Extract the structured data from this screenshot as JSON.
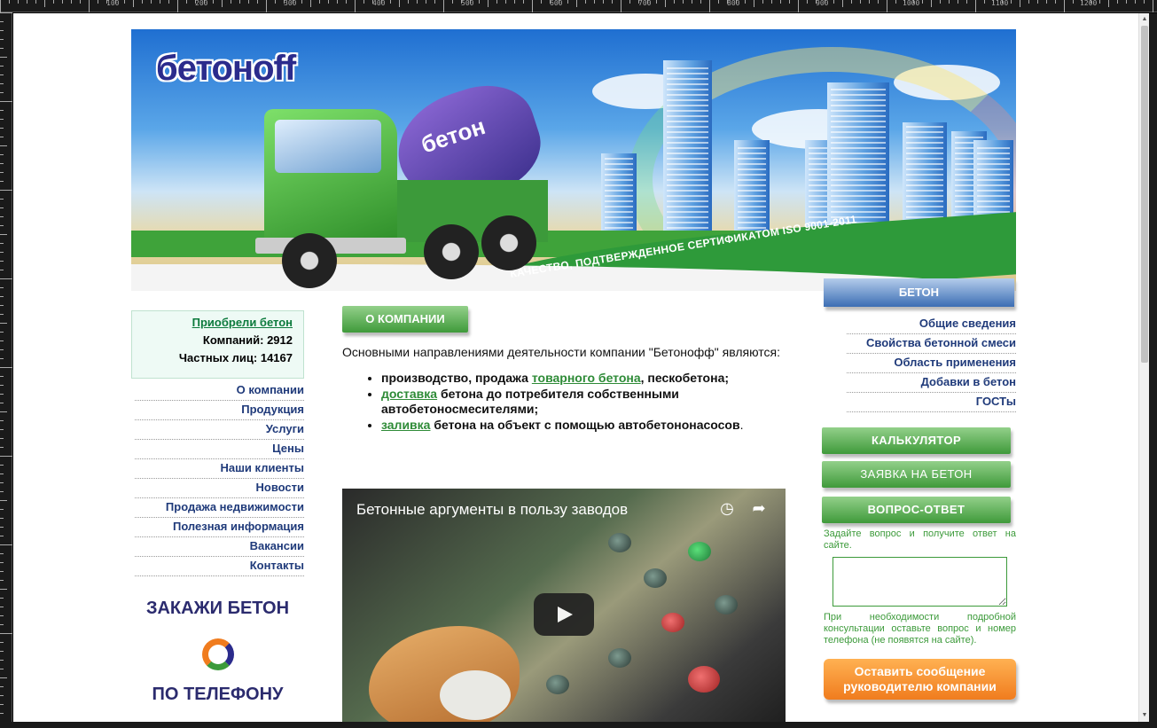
{
  "ruler": {
    "labels": [
      "100",
      "200",
      "300",
      "400",
      "500",
      "600",
      "700",
      "800",
      "900",
      "1000",
      "1100",
      "1200"
    ]
  },
  "banner": {
    "logo_text": "бетонoff",
    "truck_text": "бетон",
    "iso_caption": "КАЧЕСТВО, ПОДТВЕРЖДЕННОЕ СЕРТИФИКАТОМ ISO 9001-2011"
  },
  "buyers": {
    "title": "Приобрели бетон",
    "companies": "Компаний: 2912",
    "persons": "Частных лиц: 14167"
  },
  "left_nav": {
    "items": [
      {
        "label": "О компании"
      },
      {
        "label": "Продукция"
      },
      {
        "label": "Услуги"
      },
      {
        "label": "Цены"
      },
      {
        "label": "Наши клиенты"
      },
      {
        "label": "Новости"
      },
      {
        "label": "Продажа недвижимости"
      },
      {
        "label": "Полезная информация"
      },
      {
        "label": "Вакансии"
      },
      {
        "label": "Контакты"
      }
    ]
  },
  "order": {
    "title": "ЗАКАЖИ БЕТОН",
    "phone": "ПО ТЕЛЕФОНУ"
  },
  "main": {
    "section_button": "О КОМПАНИИ",
    "intro": "Основными направлениями деятельности компании \"Бетонофф\" являются:",
    "dir1_pre": "производство, продажа ",
    "dir1_link": "товарного бетона",
    "dir1_post": ", пескобетона;",
    "dir2_link": "доставка",
    "dir2_post": " бетона до потребителя собственными автобетоносмесителями;",
    "dir3_link": "заливка",
    "dir3_post": " бетона на объект с помощью автобетононасосов",
    "dir3_end": "."
  },
  "video": {
    "title": "Бетонные аргументы в пользу заводов"
  },
  "right": {
    "header": "БЕТОН",
    "items": [
      {
        "label": "Общие сведения"
      },
      {
        "label": "Свойства бетонной смеси"
      },
      {
        "label": "Область применения"
      },
      {
        "label": "Добавки в бетон"
      },
      {
        "label": "ГОСТы"
      }
    ],
    "calc_button": "КАЛЬКУЛЯТОР",
    "request_button": "ЗАЯВКА НА БЕТОН",
    "qa_button": "ВОПРОС-ОТВЕТ",
    "qa_text": "Задайте вопрос и получите ответ на сайте.",
    "qa_hint": "При необходимости подробной консультации оставьте вопрос и номер телефона (не появятся на сайте).",
    "message_button": "Оставить сообщение руководителю компании"
  },
  "colors": {
    "green": "#3f9a3a",
    "navy": "#1f3a7a",
    "orange": "#f07c1e",
    "blue": "#3c6eb4"
  }
}
